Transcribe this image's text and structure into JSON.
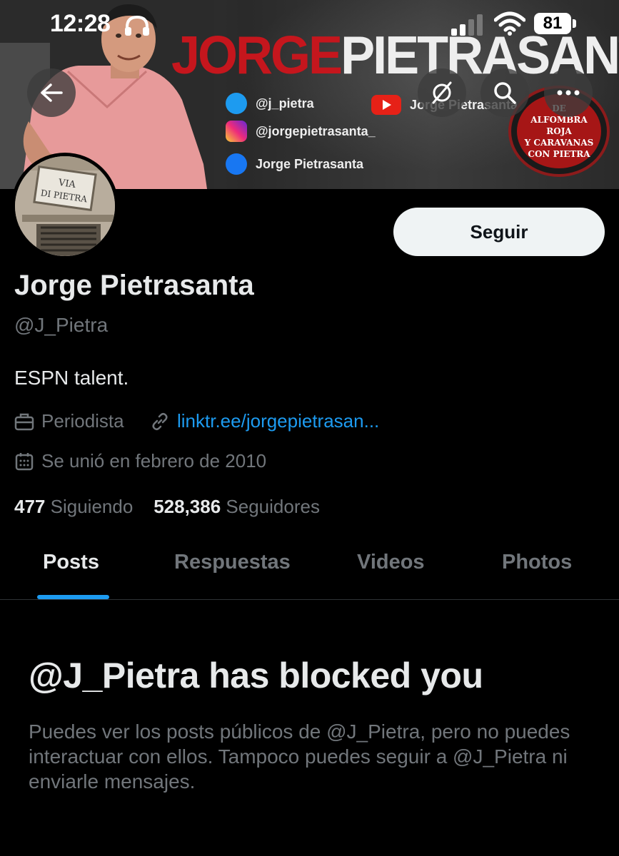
{
  "status_bar": {
    "time": "12:28",
    "battery": "81"
  },
  "banner": {
    "title_first": "JORGE",
    "title_last": "PIETRASANTA",
    "socials": {
      "twitter": "@j_pietra",
      "youtube": "Jorge Pietrasanta",
      "instagram": "@jorgepietrasanta_",
      "facebook": "Jorge Pietrasanta"
    },
    "badge_lines": [
      "DE",
      "ALFOMBRA ROJA",
      "Y CARAVANAS",
      "CON PIETRA"
    ],
    "avatar_sign_lines": [
      "VIA",
      "DI PIETRA"
    ]
  },
  "nav": {
    "back_icon": "arrow-left-icon",
    "mute_icon": "eye-slash-icon",
    "search_icon": "search-icon",
    "more_icon": "more-dots-icon"
  },
  "profile": {
    "follow_label": "Seguir",
    "name": "Jorge Pietrasanta",
    "handle": "@J_Pietra",
    "bio": "ESPN talent.",
    "profession": "Periodista",
    "link": "linktr.ee/jorgepietrasan...",
    "joined": "Se unió en febrero de 2010",
    "following_count": "477",
    "following_label": "Siguiendo",
    "followers_count": "528,386",
    "followers_label": "Seguidores"
  },
  "tabs": [
    {
      "label": "Posts",
      "active": true
    },
    {
      "label": "Respuestas",
      "active": false
    },
    {
      "label": "Videos",
      "active": false
    },
    {
      "label": "Photos",
      "active": false
    }
  ],
  "blocked": {
    "title": "@J_Pietra has blocked you",
    "text": "Puedes ver los posts públicos de @J_Pietra, pero no puedes interactuar con ellos. Tampoco puedes seguir a @J_Pietra ni enviarle mensajes."
  },
  "colors": {
    "background": "#000000",
    "accent": "#1d9bf0",
    "secondary_text": "#71767b",
    "primary_text": "#e7e9ea",
    "banner_red": "#c5161d"
  }
}
